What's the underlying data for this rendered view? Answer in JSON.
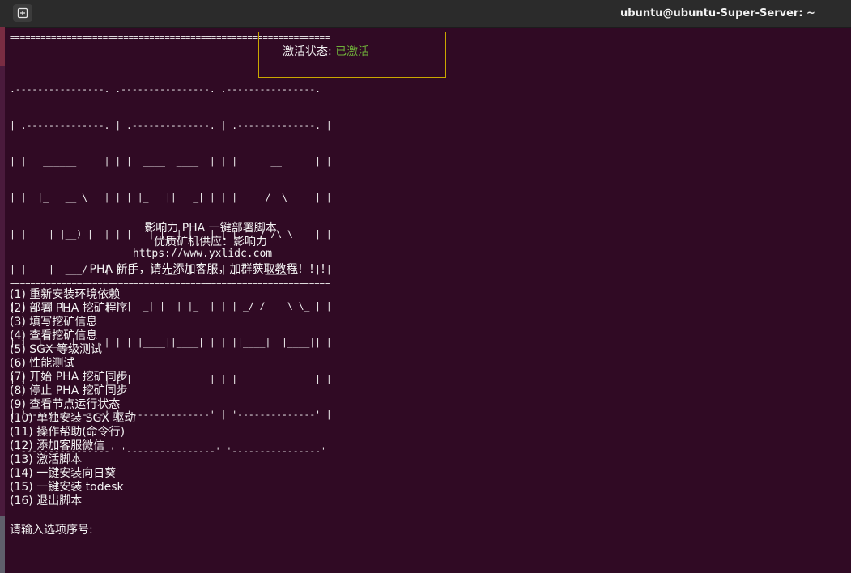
{
  "window": {
    "title": "ubuntu@ubuntu-Super-Server: ~",
    "new_tab_icon": "new-tab-icon"
  },
  "terminal": {
    "rule": "==============================================================",
    "status_label": "激活状态:",
    "status_value": "已激活",
    "ascii_art": [
      ".----------------. .----------------. .----------------.",
      "| .--------------. | .--------------. | .--------------. |",
      "| |   ______     | | |  ____  ____  | | |      __      | |",
      "| |  |_   __ \\   | | | |_   ||   _| | | |     /  \\     | |",
      "| |    | |__) |  | | |   | |__| |   | | |    / /\\ \\    | |",
      "| |    |  ___/   | | |   |  __  |   | | |   / ____ \\   | |",
      "| |   _| |_      | | |  _| |  | |_  | | | _/ /    \\ \\_ | |",
      "| |  |_____|     | | | |____||____| | | ||____|  |____|| |",
      "| |              | | |              | | |              | |",
      "| '--------------' | '--------------' | '--------------' |",
      " '----------------' '----------------' '----------------'"
    ],
    "banner_title": "影响力 PHA 一键部署脚本",
    "banner_supplier": "优质矿机供应：影响力",
    "banner_url": "https://www.yxlidc.com",
    "banner_notice": "PHA 新手，请先添加客服，加群获取教程！！！",
    "menu": [
      "(1) 重新安装环境依赖",
      "(2) 部署 PHA 挖矿程序",
      "(3) 填写挖矿信息",
      "(4) 查看挖矿信息",
      "(5) SGX 等级测试",
      "(6) 性能测试",
      "(7) 开始 PHA 挖矿同步",
      "(8) 停止 PHA 挖矿同步",
      "(9) 查看节点运行状态",
      "(10) 单独安装 SGX 驱动",
      "(11) 操作帮助(命令行)",
      "(12) 添加客服微信",
      "(13) 激活脚本",
      "(14) 一键安装向日葵",
      "(15) 一键安装 todesk",
      "(16) 退出脚本"
    ],
    "prompt": "请输入选项序号:"
  },
  "colors": {
    "background": "#300a24",
    "titlebar": "#2b2b2b",
    "status_active": "#6fb03a",
    "highlight_box": "#c9a800"
  }
}
